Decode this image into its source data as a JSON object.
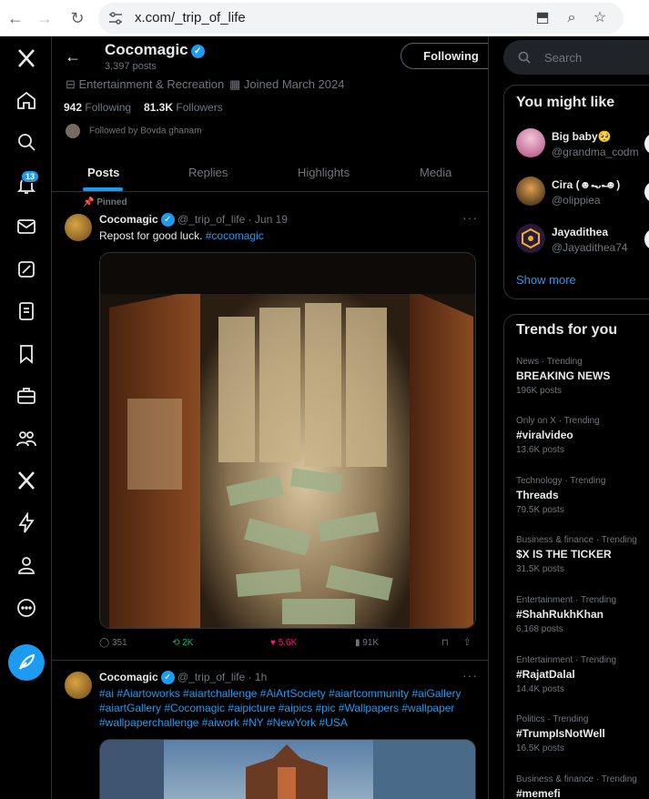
{
  "browser": {
    "url": "x.com/_trip_of_life"
  },
  "nav": {
    "notifications_badge": "13"
  },
  "profile": {
    "name": "Cocomagic",
    "posts_count": "3,397 posts",
    "follow_button": "Following",
    "category": "Entertainment & Recreation",
    "joined": "Joined March 2024",
    "following_count": "942",
    "following_label": "Following",
    "followers_count": "81.3K",
    "followers_label": "Followers",
    "followed_by": "Followed by Bovda ghanam"
  },
  "tabs": [
    "Posts",
    "Replies",
    "Highlights",
    "Media"
  ],
  "tweets": [
    {
      "pinned_label": "Pinned",
      "name": "Cocomagic",
      "handle_time": "@_trip_of_life · Jun 19",
      "text_plain": "Repost for good luck. ",
      "text_tag": "#cocomagic",
      "replies": "351",
      "reposts": "2K",
      "likes": "5.6K",
      "views": "91K"
    },
    {
      "name": "Cocomagic",
      "handle_time": "@_trip_of_life · 1h",
      "text": "#ai #Aiartoworks #aiartchallenge #AiArtSociety #aiartcommunity #aiGallery #aiartGallery #Cocomagic #aipicture #aipics #pic #Wallpapers #wallpaper #wallpaperchallenge #aiwork #NY #NewYork #USA"
    }
  ],
  "sidebar": {
    "search_placeholder": "Search",
    "you_might_like": {
      "title": "You might like",
      "items": [
        {
          "name": "Big baby🥺",
          "handle": "@grandma_codm"
        },
        {
          "name": "Cira (☻-̶̶ᴗ-̶̶☻)",
          "handle": "@olippiea"
        },
        {
          "name": "Jayadithea",
          "handle": "@Jayadithea74"
        }
      ],
      "show_more": "Show more"
    },
    "trends": {
      "title": "Trends for you",
      "items": [
        {
          "category": "News · Trending",
          "name": "BREAKING NEWS",
          "count": "196K posts"
        },
        {
          "category": "Only on X · Trending",
          "name": "#viralvideo",
          "count": "13.6K posts"
        },
        {
          "category": "Technology · Trending",
          "name": "Threads",
          "count": "79.5K posts"
        },
        {
          "category": "Business & finance · Trending",
          "name": "$X IS THE TICKER",
          "count": "31.5K posts"
        },
        {
          "category": "Entertainment · Trending",
          "name": "#ShahRukhKhan",
          "count": "6,168 posts"
        },
        {
          "category": "Entertainment · Trending",
          "name": "#RajatDalal",
          "count": "14.4K posts"
        },
        {
          "category": "Politics · Trending",
          "name": "#TrumpIsNotWell",
          "count": "16.5K posts"
        },
        {
          "category": "Business & finance · Trending",
          "name": "#memefi",
          "count": ""
        }
      ]
    }
  },
  "colors": {
    "accent": "#1d9bf0",
    "repost_green": "#00ba7c",
    "like_pink": "#f91880"
  }
}
